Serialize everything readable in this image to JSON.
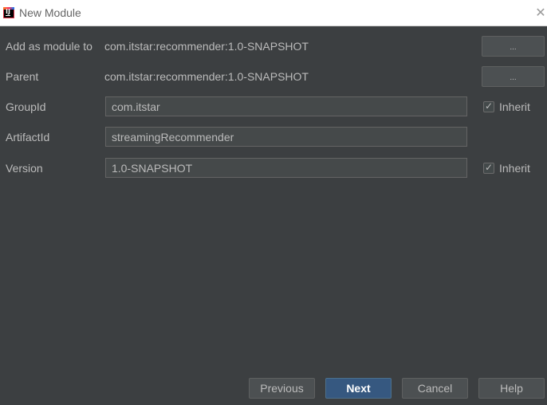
{
  "window": {
    "title": "New Module",
    "close_glyph": "✕"
  },
  "form": {
    "add_as_module_to": {
      "label": "Add as module to",
      "value": "com.itstar:recommender:1.0-SNAPSHOT",
      "button": "..."
    },
    "parent": {
      "label": "Parent",
      "value": "com.itstar:recommender:1.0-SNAPSHOT",
      "button": "..."
    },
    "group_id": {
      "label": "GroupId",
      "value": "com.itstar",
      "inherit_label": "Inherit",
      "inherit_checked": true
    },
    "artifact_id": {
      "label": "ArtifactId",
      "value": "streamingRecommender"
    },
    "version": {
      "label": "Version",
      "value": "1.0-SNAPSHOT",
      "inherit_label": "Inherit",
      "inherit_checked": true
    }
  },
  "buttons": {
    "previous": "Previous",
    "next": "Next",
    "cancel": "Cancel",
    "help": "Help"
  },
  "check_glyph": "✓",
  "colors": {
    "background": "#3c3f41",
    "primary_button": "#365880",
    "field_background": "#45494a"
  }
}
